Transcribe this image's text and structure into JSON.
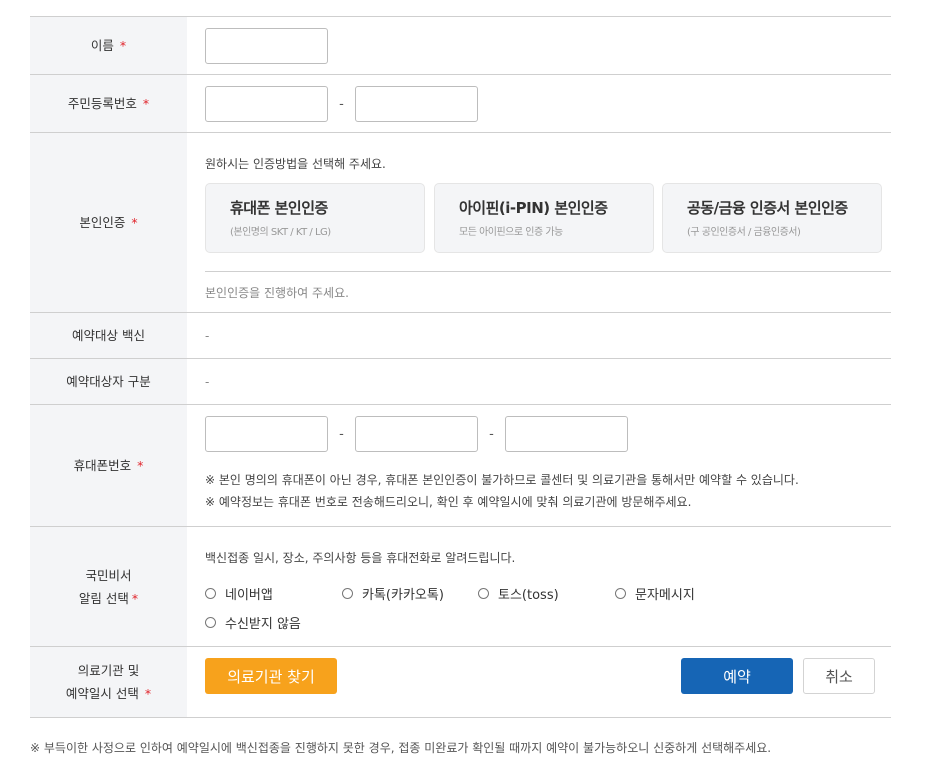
{
  "required_mark": "*",
  "name": {
    "label": "이름"
  },
  "resident": {
    "label": "주민등록번호",
    "dash": "-"
  },
  "auth": {
    "label": "본인인증",
    "instruction": "원하시는 인증방법을 선택해 주세요.",
    "methods": [
      {
        "title": "휴대폰 본인인증",
        "sub": "(본인명의 SKT / KT / LG)"
      },
      {
        "title": "아이핀(i-PIN) 본인인증",
        "sub": "모든 아이핀으로 인증 가능"
      },
      {
        "title": "공동/금융 인증서 본인인증",
        "sub": "(구 공인인증서 / 금융인증서)"
      }
    ],
    "status": "본인인증을 진행하여 주세요."
  },
  "vaccine": {
    "label": "예약대상 백신",
    "value": "-"
  },
  "target": {
    "label": "예약대상자 구분",
    "value": "-"
  },
  "phone": {
    "label": "휴대폰번호",
    "dash": "-",
    "notices": [
      "※ 본인 명의의 휴대폰이 아닌 경우, 휴대폰 본인인증이 불가하므로 콜센터 및 의료기관을 통해서만 예약할 수 있습니다.",
      "※ 예약정보는 휴대폰 번호로 전송해드리오니, 확인 후 예약일시에 맞춰 의료기관에 방문해주세요."
    ]
  },
  "alert": {
    "label_line1": "국민비서",
    "label_line2": "알림 선택",
    "description": "백신접종 일시, 장소, 주의사항 등을 휴대전화로 알려드립니다.",
    "options": [
      "네이버앱",
      "카톡(카카오톡)",
      "토스(toss)",
      "문자메시지",
      "수신받지 않음"
    ]
  },
  "clinic": {
    "label_line1": "의료기관 및",
    "label_line2": "예약일시 선택",
    "find_button": "의료기관 찾기",
    "reserve_button": "예약",
    "cancel_button": "취소"
  },
  "footnote": "※ 부득이한 사정으로 인하여 예약일시에 백신접종을 진행하지 못한 경우, 접종 미완료가 확인될 때까지 예약이 불가능하오니 신중하게 선택해주세요.",
  "colors": {
    "find_button": "#f7a21c",
    "reserve_button": "#1665b5",
    "required": "#e0242b",
    "label_bg": "#f4f5f7"
  }
}
